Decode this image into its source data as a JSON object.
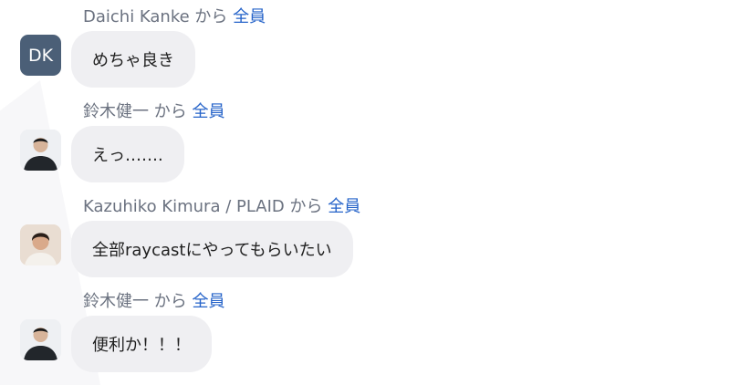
{
  "chat": {
    "messages": [
      {
        "sender": "Daichi Kanke",
        "sep": " から ",
        "recipient": "全員",
        "avatar_text": "DK",
        "avatar_type": "initials",
        "text": "めちゃ良き"
      },
      {
        "sender": "鈴木健一",
        "sep": " から ",
        "recipient": "全員",
        "avatar_type": "photo",
        "text": "えっ……."
      },
      {
        "sender": "Kazuhiko Kimura / PLAID",
        "sep": " から ",
        "recipient": "全員",
        "avatar_type": "photo",
        "text": "全部raycastにやってもらいたい"
      },
      {
        "sender": "鈴木健一",
        "sep": " から ",
        "recipient": "全員",
        "avatar_type": "photo",
        "text": "便利か！！！"
      }
    ]
  },
  "colors": {
    "sender_text": "#6b7280",
    "recipient_link": "#2563c9",
    "bubble_bg": "#efeff2",
    "initials_avatar_bg": "#4b5f77"
  }
}
